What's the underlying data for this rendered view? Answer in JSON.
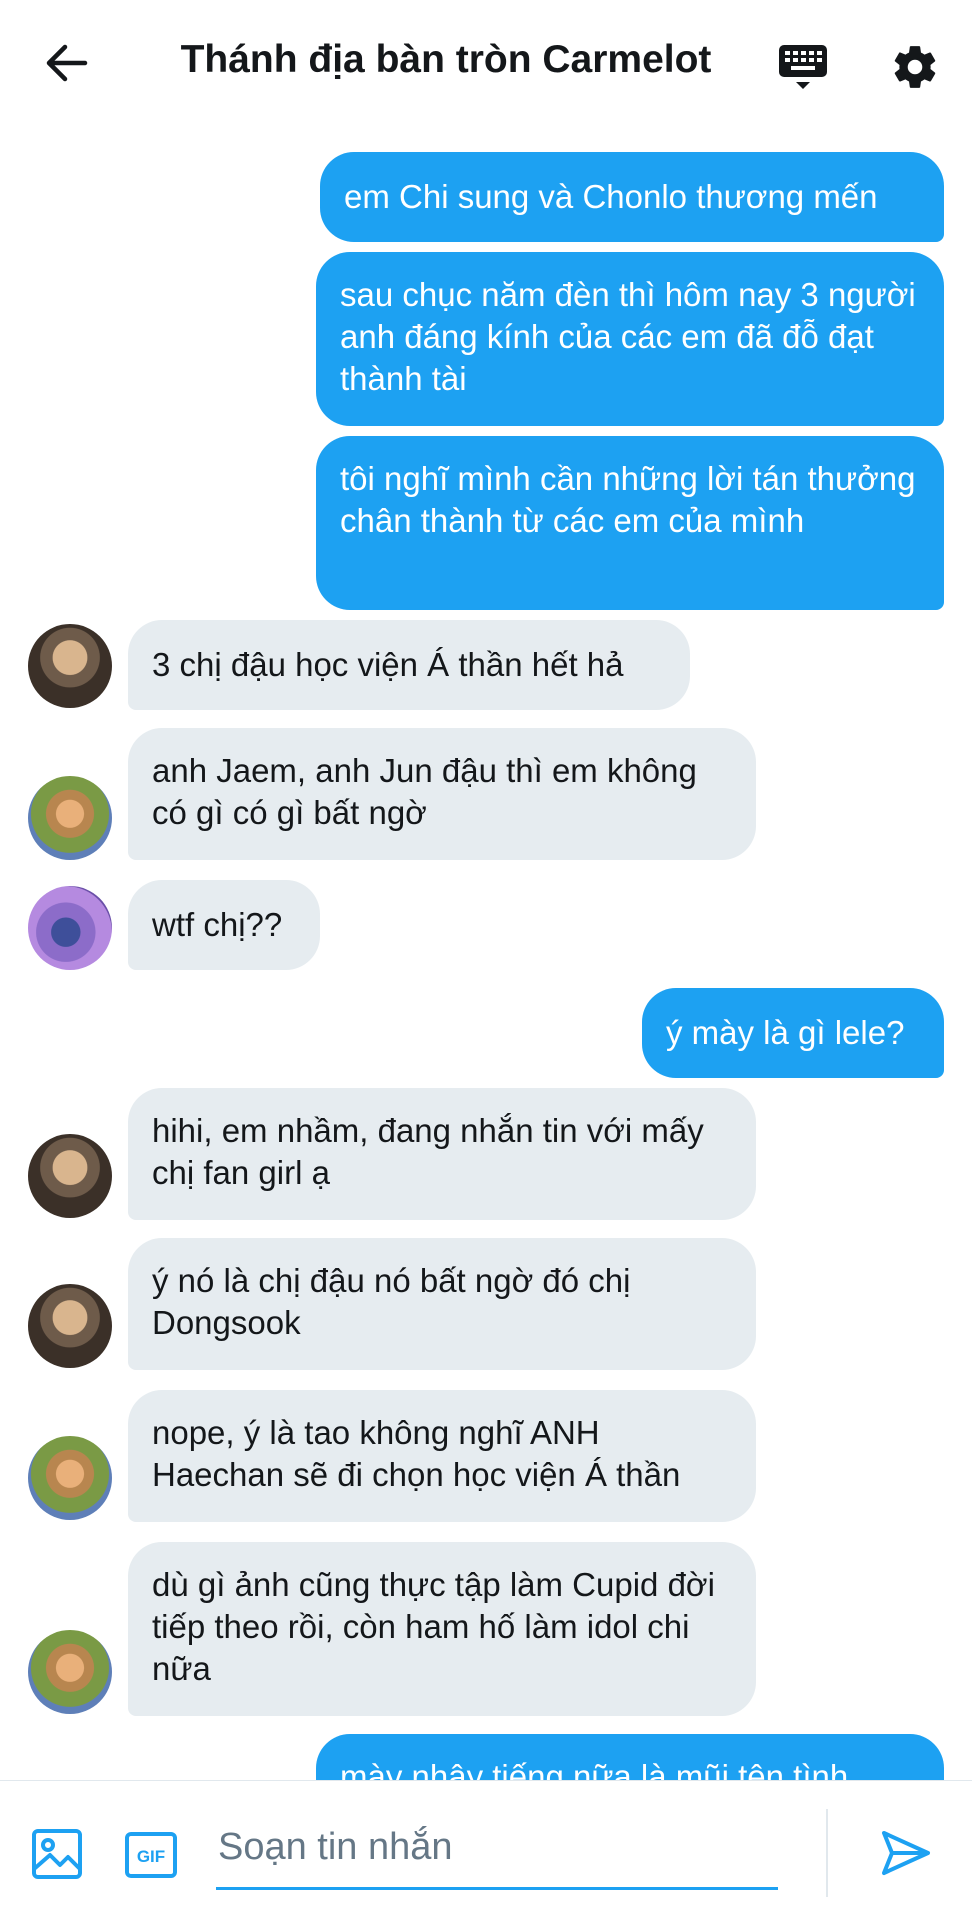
{
  "header": {
    "title": "Thánh địa bàn tròn Carmelot"
  },
  "messages": [
    {
      "id": 1,
      "direction": "outgoing",
      "text": "em Chi sung và Chonlo thương mến"
    },
    {
      "id": 2,
      "direction": "outgoing",
      "text": "sau chục năm đèn thì hôm nay 3 người anh đáng kính của các em đã đỗ đạt thành tài"
    },
    {
      "id": 3,
      "direction": "outgoing",
      "text": "tôi nghĩ mình cần những lời tán thưởng chân thành từ các em của mình"
    },
    {
      "id": 4,
      "direction": "incoming",
      "avatar": "avatar-a",
      "text": "3 chị đậu học viện Á thần hết hả"
    },
    {
      "id": 5,
      "direction": "incoming",
      "avatar": "avatar-b",
      "text": "anh Jaem, anh Jun đậu thì em không có gì có gì bất ngờ"
    },
    {
      "id": 6,
      "direction": "incoming",
      "avatar": "avatar-c",
      "text": "wtf chị??"
    },
    {
      "id": 7,
      "direction": "outgoing",
      "text": "ý mày là gì lele?"
    },
    {
      "id": 8,
      "direction": "incoming",
      "avatar": "avatar-a",
      "text": "hihi, em nhầm, đang nhắn tin với mấy chị fan girl ạ"
    },
    {
      "id": 9,
      "direction": "incoming",
      "avatar": "avatar-a",
      "text": "ý nó là chị đậu nó bất ngờ đó chị Dongsook"
    },
    {
      "id": 10,
      "direction": "incoming",
      "avatar": "avatar-b",
      "text": "nope, ý là tao không nghĩ ANH Haechan sẽ đi chọn học viện Á thần"
    },
    {
      "id": 11,
      "direction": "incoming",
      "avatar": "avatar-b",
      "text": "dù gì ảnh cũng thực tập làm Cupid đời tiếp theo rồi, còn ham hố làm idol chi nữa"
    },
    {
      "id": 12,
      "direction": "outgoing",
      "text": "mày nhây tiếng nữa là mũi tên tình"
    }
  ],
  "composer": {
    "placeholder": "Soạn tin nhắn",
    "gif_label": "GIF"
  },
  "colors": {
    "accent": "#1da1f2",
    "incoming_bubble": "#e6ecf0",
    "outgoing_text": "#ffffff",
    "incoming_text": "#14171a"
  },
  "icons": {
    "back": "arrow-left-icon",
    "keyboard": "keyboard-icon",
    "settings": "gear-icon",
    "image": "image-icon",
    "gif": "gif-icon",
    "send": "send-icon"
  }
}
